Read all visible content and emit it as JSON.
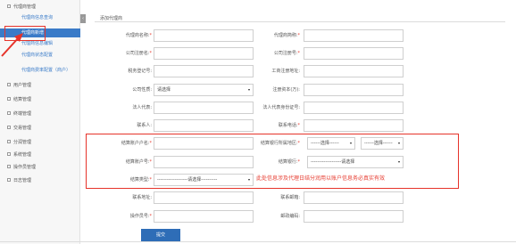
{
  "sidebar": {
    "groups": [
      {
        "label": "代理商管理"
      },
      {
        "label": "用户管理"
      },
      {
        "label": "结算管理"
      },
      {
        "label": "终端管理"
      },
      {
        "label": "交易管理"
      },
      {
        "label": "分润管理"
      },
      {
        "label": "系统管理"
      },
      {
        "label": "操作员管理"
      },
      {
        "label": "日志管理"
      }
    ],
    "sub_items": [
      {
        "label": "代理商信息查询"
      },
      {
        "label": "代理商新增"
      },
      {
        "label": "代理商信息编辑"
      },
      {
        "label": "代理商状态配置"
      },
      {
        "label": "代理商费率配置（商户）"
      }
    ],
    "collapse_glyph": "‹"
  },
  "page": {
    "title": "添加代理商"
  },
  "form": {
    "agent_name": {
      "label": "代理商名称:",
      "required": "*"
    },
    "agent_short": {
      "label": "代理商简称:",
      "required": "*"
    },
    "company_reg_name": {
      "label": "公司注册名:",
      "required": "*"
    },
    "company_reg_no": {
      "label": "公司注册号:",
      "required": "*"
    },
    "tax_reg_no": {
      "label": "税务登记号:",
      "required": ""
    },
    "biz_reg_address": {
      "label": "工商注册地址:",
      "required": ""
    },
    "company_nature": {
      "label": "公司性质:",
      "required": "",
      "selected": "请选择"
    },
    "reg_capital": {
      "label": "注册资本(万):",
      "required": ""
    },
    "legal_rep": {
      "label": "法人代表:",
      "required": ""
    },
    "legal_rep_id": {
      "label": "法人代表身份证号:",
      "required": ""
    },
    "contact": {
      "label": "联系人:",
      "required": ""
    },
    "contact_phone": {
      "label": "联系电话:",
      "required": "*"
    },
    "settle_account_name": {
      "label": "结算账户户名:",
      "required": "*"
    },
    "settle_bank_region": {
      "label": "结算银行所属地区:",
      "required": "*",
      "province": "------选择------",
      "city": "------选择------"
    },
    "settle_account_no": {
      "label": "结算账户号:",
      "required": "*"
    },
    "settle_bank": {
      "label": "结算银行:",
      "required": "*",
      "selected": "-------------------请选择"
    },
    "settle_type": {
      "label": "结算类型:",
      "required": "*",
      "selected": "-------------------请选择----------"
    },
    "contact_address": {
      "label": "联系地址:",
      "required": ""
    },
    "contact_email": {
      "label": "联系邮箱:",
      "required": ""
    },
    "operator_no": {
      "label": "操作员号:",
      "required": "*"
    },
    "zip_code": {
      "label": "邮政编码:",
      "required": ""
    },
    "caret_glyph": "▾"
  },
  "settle_note": "此处信息涉及代理日结分润用以账户信息务必真实有效",
  "submit_label": "提交",
  "colors": {
    "accent": "#2e6db7",
    "highlight": "#e6332a",
    "active_nav": "#3a7bc8"
  }
}
